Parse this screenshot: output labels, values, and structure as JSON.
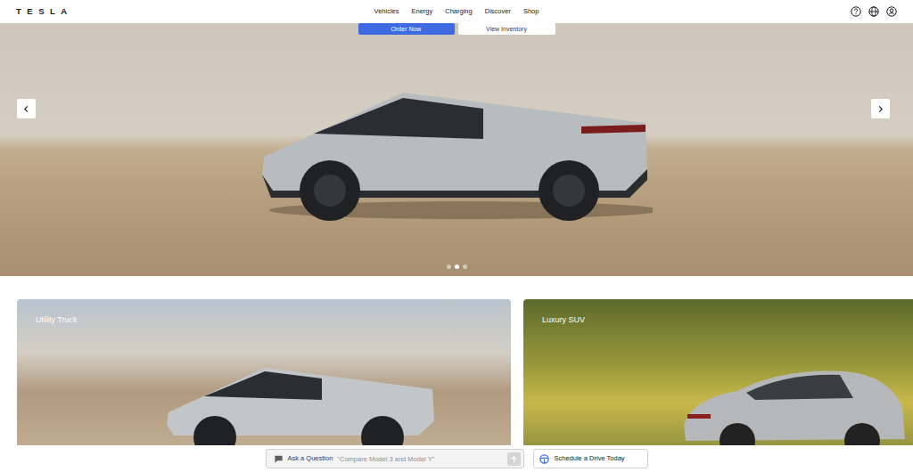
{
  "header": {
    "logo": "TESLA",
    "nav": [
      {
        "label": "Vehicles"
      },
      {
        "label": "Energy"
      },
      {
        "label": "Charging"
      },
      {
        "label": "Discover"
      },
      {
        "label": "Shop"
      }
    ]
  },
  "hero": {
    "buttons": [
      "Order Now",
      "View Inventory"
    ],
    "slides": [
      {
        "selected": false
      },
      {
        "selected": true
      },
      {
        "selected": false
      }
    ]
  },
  "cards": [
    {
      "label": "Utility Truck"
    },
    {
      "label": "Luxury SUV"
    }
  ],
  "assistant": {
    "label": "Ask a Question",
    "placeholder": "\"Compare Model 3 and Model Y\"",
    "drive_button": "Schedule a Drive Today"
  }
}
